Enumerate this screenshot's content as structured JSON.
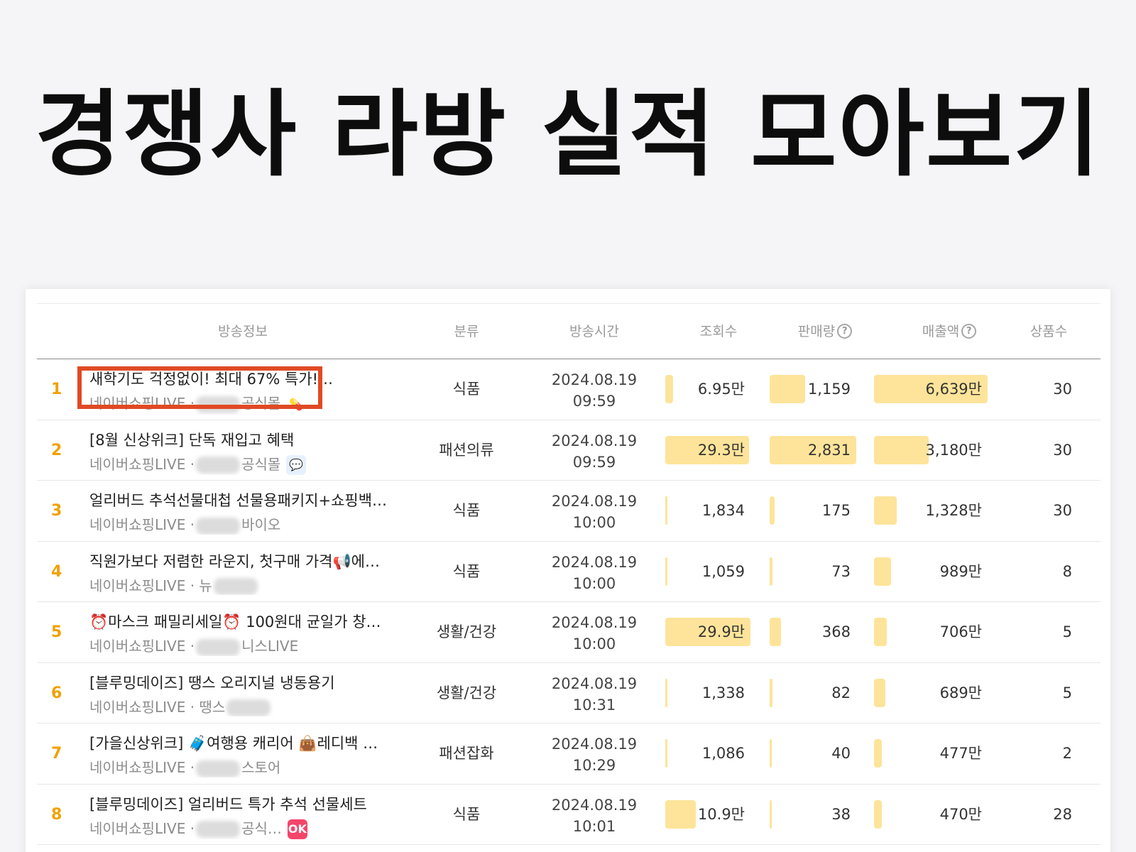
{
  "headline": "경쟁사 라방 실적 모아보기",
  "columns": {
    "info": "방송정보",
    "category": "분류",
    "time": "방송시간",
    "views": "조회수",
    "sales": "판매량",
    "revenue": "매출액",
    "products": "상품수",
    "help_icon": "?"
  },
  "accent": {
    "bar": "#fde49a",
    "rank": "#f0a100",
    "highlight": "#e04a24"
  },
  "rows": [
    {
      "rank": "1",
      "title": "새학기도 걱정없이! 최대 67% 특가!…",
      "channel": "네이버쇼핑LIVE ·",
      "store": "공식몰",
      "badge_icon": "pill-icon",
      "category": "식품",
      "date": "2024.08.19",
      "time": "09:59",
      "views": "6.95만",
      "views_level": 0.09,
      "sales": "1,159",
      "sales_level": 0.41,
      "revenue": "6,639만",
      "revenue_level": 1.0,
      "products": "30"
    },
    {
      "rank": "2",
      "title": "[8월 신상위크] 단독 재입고 혜택",
      "channel": "네이버쇼핑LIVE ·",
      "store": "공식몰",
      "badge_icon": "speech-bubble-icon",
      "category": "패션의류",
      "date": "2024.08.19",
      "time": "09:59",
      "views": "29.3만",
      "views_level": 0.98,
      "sales": "2,831",
      "sales_level": 1.0,
      "revenue": "3,180만",
      "revenue_level": 0.48,
      "products": "30"
    },
    {
      "rank": "3",
      "title": "얼리버드 추석선물대첩 선물용패키지+쇼핑백…",
      "channel": "네이버쇼핑LIVE ·",
      "store": "바이오",
      "badge_icon": "",
      "category": "식품",
      "date": "2024.08.19",
      "time": "10:00",
      "views": "1,834",
      "views_level": 0.006,
      "sales": "175",
      "sales_level": 0.06,
      "revenue": "1,328만",
      "revenue_level": 0.2,
      "products": "30"
    },
    {
      "rank": "4",
      "title": "직원가보다 저렴한 라운지, 첫구매 가격📢에…",
      "channel": "네이버쇼핑LIVE · 뉴",
      "store": "",
      "badge_icon": "",
      "category": "식품",
      "date": "2024.08.19",
      "time": "10:00",
      "views": "1,059",
      "views_level": 0.004,
      "sales": "73",
      "sales_level": 0.03,
      "revenue": "989만",
      "revenue_level": 0.15,
      "products": "8"
    },
    {
      "rank": "5",
      "title": "⏰마스크 패밀리세일⏰ 100원대 균일가 창…",
      "channel": "네이버쇼핑LIVE ·",
      "store": "니스LIVE",
      "badge_icon": "",
      "category": "생활/건강",
      "date": "2024.08.19",
      "time": "10:00",
      "views": "29.9만",
      "views_level": 1.0,
      "sales": "368",
      "sales_level": 0.13,
      "revenue": "706만",
      "revenue_level": 0.11,
      "products": "5"
    },
    {
      "rank": "6",
      "title": "[블루밍데이즈] 땡스 오리지널 냉동용기",
      "channel": "네이버쇼핑LIVE · 땡스",
      "store": "",
      "badge_icon": "",
      "category": "생활/건강",
      "date": "2024.08.19",
      "time": "10:31",
      "views": "1,338",
      "views_level": 0.005,
      "sales": "82",
      "sales_level": 0.03,
      "revenue": "689만",
      "revenue_level": 0.1,
      "products": "5"
    },
    {
      "rank": "7",
      "title": "[가을신상위크] 🧳여행용 캐리어 👜레디백 …",
      "channel": "네이버쇼핑LIVE ·",
      "store": "스토어",
      "badge_icon": "",
      "category": "패션잡화",
      "date": "2024.08.19",
      "time": "10:29",
      "views": "1,086",
      "views_level": 0.004,
      "sales": "40",
      "sales_level": 0.015,
      "revenue": "477만",
      "revenue_level": 0.07,
      "products": "2"
    },
    {
      "rank": "8",
      "title": "[블루밍데이즈] 얼리버드 특가 추석 선물세트",
      "channel": "네이버쇼핑LIVE ·",
      "store": "공식…",
      "badge_icon": "ok-badge-icon",
      "category": "식품",
      "date": "2024.08.19",
      "time": "10:01",
      "views": "10.9만",
      "views_level": 0.36,
      "sales": "38",
      "sales_level": 0.013,
      "revenue": "470만",
      "revenue_level": 0.07,
      "products": "28"
    }
  ]
}
